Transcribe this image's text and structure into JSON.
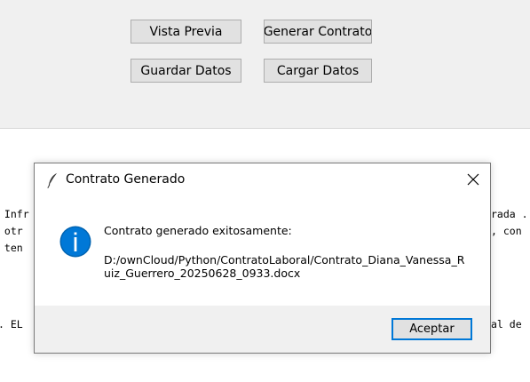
{
  "toolbar": {
    "preview_label": "Vista Previa",
    "generate_label": "Generar Contrato",
    "save_label": "Guardar Datos",
    "load_label": "Cargar Datos"
  },
  "background_text": {
    "line1_left": " Infr",
    "line1_right": "rada .",
    "line2_left": " otr",
    "line2_right": ", con",
    "line3_left": " ten",
    "line4_left": ". EL ",
    "line4_right": "al de"
  },
  "dialog": {
    "title": "Contrato Generado",
    "message": "Contrato generado exitosamente:",
    "path": "D:/ownCloud/Python/ContratoLaboral/Contrato_Diana_Vanessa_Ruiz_Guerrero_20250628_0933.docx",
    "ok_label": "Aceptar"
  },
  "icons": {
    "title_icon": "feather-icon",
    "message_icon": "info-icon",
    "close_icon": "close-icon"
  },
  "colors": {
    "accent": "#0078d7",
    "panel": "#f0f0f0",
    "button_face": "#e1e1e1"
  }
}
